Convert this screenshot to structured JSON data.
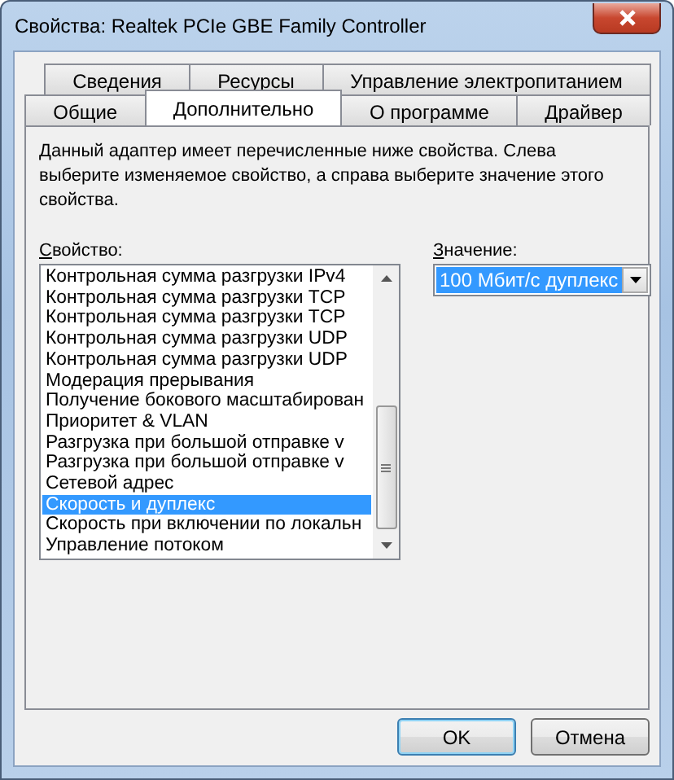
{
  "window": {
    "title": "Свойства: Realtek PCIe GBE Family Controller"
  },
  "tab_rows": [
    [
      {
        "label": "Сведения",
        "selected": false
      },
      {
        "label": "Ресурсы",
        "selected": false
      },
      {
        "label": "Управление электропитанием",
        "selected": false
      }
    ],
    [
      {
        "label": "Общие",
        "selected": false
      },
      {
        "label": "Дополнительно",
        "selected": true
      },
      {
        "label": "О программе",
        "selected": false
      },
      {
        "label": "Драйвер",
        "selected": false
      }
    ]
  ],
  "description": "Данный адаптер имеет перечисленные ниже свойства. Слева выберите изменяемое свойство, а справа выберите значение этого свойства.",
  "property": {
    "label": "Свойство:",
    "items": [
      {
        "label": "Контрольная сумма разгрузки IPv4",
        "selected": false
      },
      {
        "label": "Контрольная сумма разгрузки TCP",
        "selected": false
      },
      {
        "label": "Контрольная сумма разгрузки TCP",
        "selected": false
      },
      {
        "label": "Контрольная сумма разгрузки UDP",
        "selected": false
      },
      {
        "label": "Контрольная сумма разгрузки UDP",
        "selected": false
      },
      {
        "label": "Модерация прерывания",
        "selected": false
      },
      {
        "label": "Получение бокового масштабирован",
        "selected": false
      },
      {
        "label": "Приоритет & VLAN",
        "selected": false
      },
      {
        "label": "Разгрузка при большой отправке v",
        "selected": false
      },
      {
        "label": "Разгрузка при большой отправке v",
        "selected": false
      },
      {
        "label": "Сетевой адрес",
        "selected": false
      },
      {
        "label": "Скорость и дуплекс",
        "selected": true
      },
      {
        "label": "Скорость при включении по локальн",
        "selected": false
      },
      {
        "label": "Управление потоком",
        "selected": false
      }
    ]
  },
  "value": {
    "label": "Значение:",
    "value": "100 Мбит/с дуплекс"
  },
  "buttons": [
    {
      "label": "OK",
      "kind": "default"
    },
    {
      "label": "Отмена",
      "kind": "normal"
    }
  ]
}
